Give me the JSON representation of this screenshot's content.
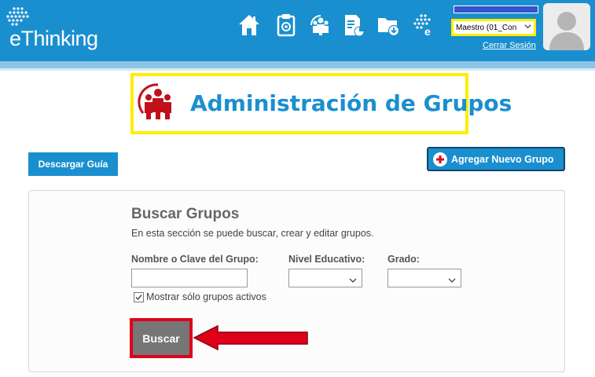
{
  "header": {
    "logo_text": "eThinking",
    "role_select_value": "Maestro (01_Con",
    "logout_label": "Cerrar Sesión",
    "nav_icons": [
      "home-icon",
      "clipboard-icon",
      "groups-icon",
      "report-icon",
      "folder-download-icon",
      "e-network-icon"
    ]
  },
  "page": {
    "title": "Administración de Grupos"
  },
  "actions": {
    "download_guide_label": "Descargar Guía",
    "add_group_label": "Agregar Nuevo Grupo"
  },
  "search": {
    "title": "Buscar Grupos",
    "description": "En esta sección se puede buscar, crear y editar grupos.",
    "name_label": "Nombre o Clave del Grupo:",
    "name_value": "",
    "level_label": "Nivel Educativo:",
    "level_value": "",
    "grade_label": "Grado:",
    "grade_value": "",
    "active_only_label": "Mostrar sólo grupos activos",
    "active_only_checked": true,
    "search_button_label": "Buscar"
  },
  "colors": {
    "brand_blue": "#1a8fcf",
    "highlight_yellow": "#ffee00",
    "highlight_red": "#e0001a",
    "icon_red": "#c0101a"
  }
}
